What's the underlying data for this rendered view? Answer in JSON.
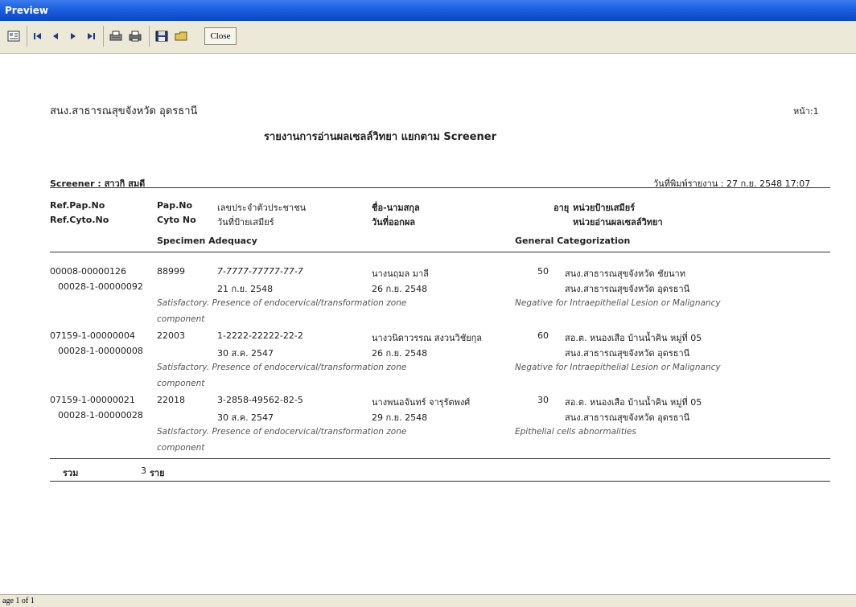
{
  "window": {
    "title": "Preview"
  },
  "toolbar": {
    "close_label": "Close"
  },
  "report": {
    "org": "สนง.สาธารณสุขจังหวัด อุดรธานี",
    "page_label": "หน้า:1",
    "title": "รายงานการอ่านผลเซลล์วิทยา แยกตาม Screener",
    "screener_line": "Screener : สาวกิ  สมดี",
    "print_date": "วันที่พิมพ์รายงาน : 27 ก.ย. 2548 17:07",
    "headers": {
      "ref_pap": "Ref.Pap.No",
      "ref_cyto": "Ref.Cyto.No",
      "pap_no": "Pap.No",
      "cyto_no": "Cyto No",
      "id_no": "เลขประจำตัวประชาชน",
      "collect_date": "วันที่ป้ายเสมียร์",
      "patient": "ชื่อ-นามสกุล",
      "result_date": "วันที่ออกผล",
      "age": "อายุ",
      "source_unit": "หน่วยป้ายเสมียร์",
      "lab_unit": "หน่วยอ่านผลเซลล์วิทยา",
      "adequacy": "Specimen Adequacy",
      "general": "General Categorization"
    },
    "rows": [
      {
        "ref_pap": "00008-00000126",
        "ref_cyto": "00028-1-00000092",
        "pap_no": "88999",
        "id_no": "7-7777-77777-77-7",
        "collect_date": "21 ก.ย. 2548",
        "patient": "นางนฤมล มาลี",
        "result_date": "26 ก.ย. 2548",
        "age": "50",
        "source_unit": "สนง.สาธารณสุขจังหวัด ชัยนาท",
        "lab_unit": "สนง.สาธารณสุขจังหวัด อุดรธานี",
        "adequacy_1": "Satisfactory. Presence of endocervical/transformation zone",
        "adequacy_2": "component",
        "general": "Negative for Intraepithelial Lesion or Malignancy"
      },
      {
        "ref_pap": "07159-1-00000004",
        "ref_cyto": "00028-1-00000008",
        "pap_no": "22003",
        "id_no": "1-2222-22222-22-2",
        "collect_date": "30 ส.ค. 2547",
        "patient": "นางวนิดาวรรณ สงวนวิชัยกุล",
        "result_date": "26 ก.ย. 2548",
        "age": "60",
        "source_unit": "สอ.ต. หนองเสือ บ้านน้ำคิน หมู่ที่ 05",
        "lab_unit": "สนง.สาธารณสุขจังหวัด อุดรธานี",
        "adequacy_1": "Satisfactory. Presence of endocervical/transformation zone",
        "adequacy_2": "component",
        "general": "Negative for Intraepithelial Lesion or Malignancy"
      },
      {
        "ref_pap": "07159-1-00000021",
        "ref_cyto": "00028-1-00000028",
        "pap_no": "22018",
        "id_no": "3-2858-49562-82-5",
        "collect_date": "30 ส.ค. 2547",
        "patient": "นางพนอจันทร์ จารุรัตพงศ์",
        "result_date": "29 ก.ย. 2548",
        "age": "30",
        "source_unit": "สอ.ต. หนองเสือ บ้านน้ำคิน หมู่ที่ 05",
        "lab_unit": "สนง.สาธารณสุขจังหวัด อุดรธานี",
        "adequacy_1": "Satisfactory. Presence of endocervical/transformation zone",
        "adequacy_2": "component",
        "general": "Epithelial cells abnormalities"
      }
    ],
    "total_label": "รวม",
    "total_count": "3",
    "total_unit": "ราย"
  },
  "status": {
    "text": "age 1 of 1"
  }
}
